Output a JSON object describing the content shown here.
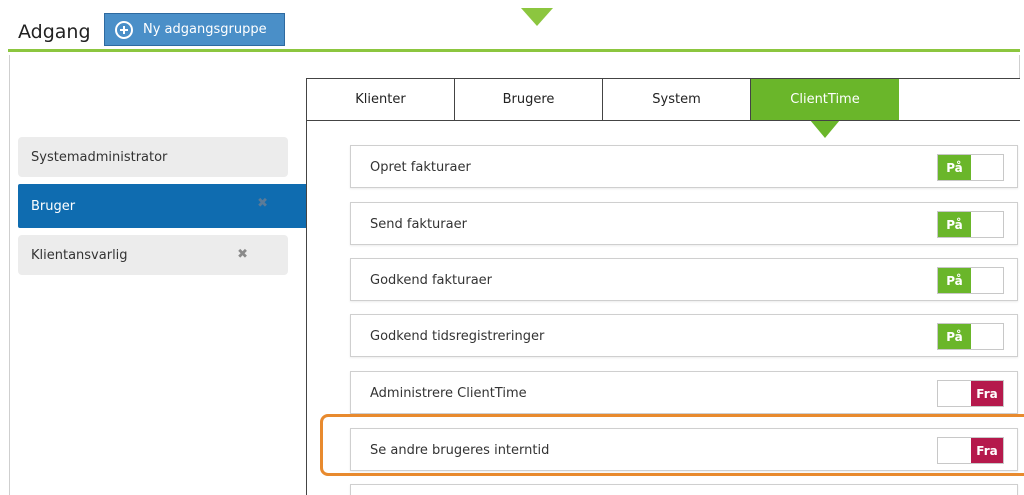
{
  "header": {
    "title": "Adgang",
    "new_group_label": "Ny adgangsgruppe"
  },
  "groups": [
    {
      "label": "Systemadministrator",
      "deletable": false,
      "selected": false
    },
    {
      "label": "Bruger",
      "deletable": true,
      "selected": true,
      "delete_symbol": "✖"
    },
    {
      "label": "Klientansvarlig",
      "deletable": true,
      "selected": false,
      "delete_symbol": "✖"
    }
  ],
  "tabs": [
    {
      "label": "Klienter",
      "active": false
    },
    {
      "label": "Brugere",
      "active": false
    },
    {
      "label": "System",
      "active": false
    },
    {
      "label": "ClientTime",
      "active": true
    }
  ],
  "permissions": [
    {
      "label": "Opret fakturaer",
      "state": "on",
      "toggle_text": "På"
    },
    {
      "label": "Send fakturaer",
      "state": "on",
      "toggle_text": "På"
    },
    {
      "label": "Godkend fakturaer",
      "state": "on",
      "toggle_text": "På"
    },
    {
      "label": "Godkend tidsregistreringer",
      "state": "on",
      "toggle_text": "På"
    },
    {
      "label": "Administrere ClientTime",
      "state": "off",
      "toggle_text": "Fra"
    },
    {
      "label": "Se andre brugeres interntid",
      "state": "off",
      "toggle_text": "Fra",
      "highlighted": true
    }
  ],
  "colors": {
    "accent_green": "#6ab62a",
    "selected_blue": "#0f6cb0",
    "button_blue": "#4a8fc8",
    "off_red": "#b5194c",
    "highlight_orange": "#e88a2e"
  }
}
